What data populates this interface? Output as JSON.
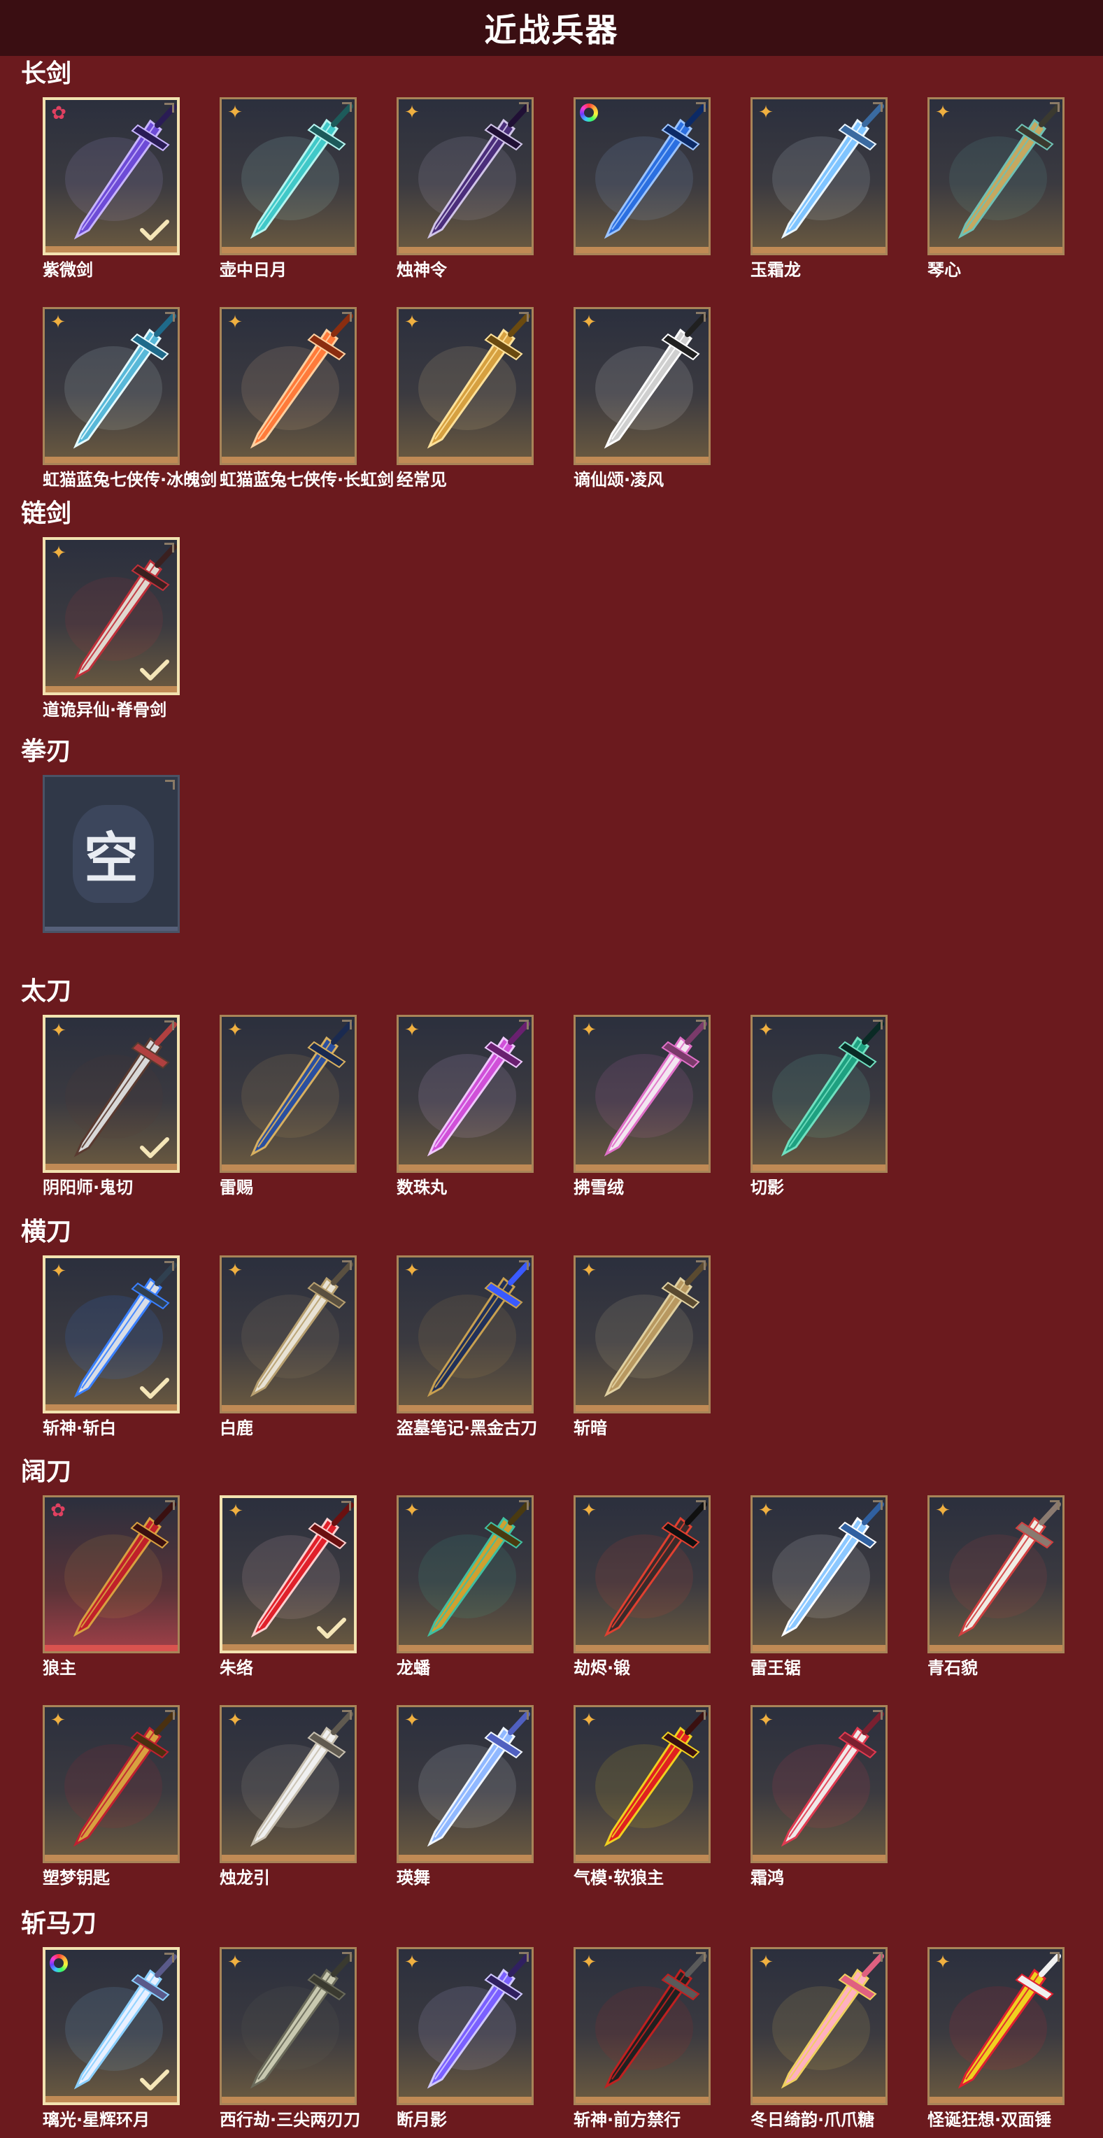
{
  "title": "近战兵器",
  "sections": [
    {
      "label": "长剑",
      "items": [
        {
          "name": "紫微剑",
          "badge": "flower-red",
          "selected": true,
          "weapon": "sword-purple"
        },
        {
          "name": "壶中日月",
          "badge": "star",
          "weapon": "sword-cyan"
        },
        {
          "name": "烛神令",
          "badge": "star",
          "weapon": "sword-dark-purple"
        },
        {
          "name": "",
          "badge": "rainbow",
          "weapon": "sword-blue"
        },
        {
          "name": "玉霜龙",
          "badge": "star",
          "weapon": "sword-ice"
        },
        {
          "name": "琴心",
          "badge": "star",
          "weapon": "sword-gold-teal"
        },
        {
          "name": "虹猫蓝兔七侠传·冰魄剑",
          "badge": "star",
          "weapon": "sword-icy-blue"
        },
        {
          "name": "虹猫蓝兔七侠传·长虹剑",
          "badge": "star",
          "weapon": "sword-orange"
        },
        {
          "name": "经常见",
          "badge": "star",
          "weapon": "sword-golden"
        },
        {
          "name": "谪仙颂·凌风",
          "badge": "star",
          "weapon": "sword-silver"
        }
      ]
    },
    {
      "label": "链剑",
      "items": [
        {
          "name": "道诡异仙·脊骨剑",
          "badge": "star",
          "selected": true,
          "weapon": "sword-bone"
        }
      ]
    },
    {
      "label": "拳刃",
      "items": [
        {
          "name": "",
          "empty": true,
          "empty_text": "空"
        }
      ]
    },
    {
      "label": "太刀",
      "items": [
        {
          "name": "阴阳师·鬼切",
          "badge": "star",
          "selected": true,
          "weapon": "katana-pair"
        },
        {
          "name": "雷赐",
          "badge": "star",
          "weapon": "katana-blue-gold"
        },
        {
          "name": "数珠丸",
          "badge": "star",
          "weapon": "katana-pink"
        },
        {
          "name": "拂雪绒",
          "badge": "star",
          "weapon": "katana-white-pink"
        },
        {
          "name": "切影",
          "badge": "star",
          "weapon": "katana-green"
        }
      ]
    },
    {
      "label": "横刀",
      "items": [
        {
          "name": "斩神·斩白",
          "badge": "star",
          "selected": true,
          "weapon": "saber-silver-blue"
        },
        {
          "name": "白鹿",
          "badge": "star",
          "weapon": "saber-white"
        },
        {
          "name": "盗墓笔记·黑金古刀",
          "badge": "star",
          "weapon": "saber-black-gold"
        },
        {
          "name": "斩暗",
          "badge": "star",
          "weapon": "saber-bronze"
        }
      ]
    },
    {
      "label": "阔刀",
      "items": [
        {
          "name": "狼主",
          "badge": "flower-red",
          "red": true,
          "weapon": "blade-red-gold"
        },
        {
          "name": "朱络",
          "badge": "star",
          "selected": true,
          "weapon": "blade-red"
        },
        {
          "name": "龙蟠",
          "badge": "star",
          "weapon": "blade-gold-green"
        },
        {
          "name": "劫烬·锻",
          "badge": "star",
          "weapon": "blade-dark-red"
        },
        {
          "name": "雷王锯",
          "badge": "star",
          "weapon": "blade-blue-white"
        },
        {
          "name": "青石貌",
          "badge": "star",
          "weapon": "blade-white-red"
        },
        {
          "name": "塑梦钥匙",
          "badge": "star",
          "weapon": "blade-gold-red"
        },
        {
          "name": "烛龙引",
          "badge": "star",
          "weapon": "blade-white-silver"
        },
        {
          "name": "瑛舞",
          "badge": "star",
          "weapon": "blade-light-blue"
        },
        {
          "name": "气模·软狼主",
          "badge": "star",
          "weapon": "blade-inflatable"
        },
        {
          "name": "霜鸿",
          "badge": "star",
          "weapon": "blade-crimson-white"
        }
      ]
    },
    {
      "label": "斩马刀",
      "items": [
        {
          "name": "璃光·星辉环月",
          "badge": "rainbow",
          "selected": true,
          "weapon": "halberd-moon"
        },
        {
          "name": "西行劫·三尖两刃刀",
          "badge": "star",
          "weapon": "halberd-trident"
        },
        {
          "name": "断月影",
          "badge": "star",
          "weapon": "halberd-purple"
        },
        {
          "name": "斩神·前方禁行",
          "badge": "star",
          "weapon": "halberd-sign"
        },
        {
          "name": "冬日绮韵·爪爪糖",
          "badge": "star",
          "weapon": "halberd-candy"
        },
        {
          "name": "怪诞狂想·双面锤",
          "badge": "star",
          "weapon": "halberd-clown"
        }
      ]
    }
  ],
  "colors": {
    "background": "#6b1a1e",
    "titlebar": "#3a0e12",
    "card_border": "#a88458",
    "selected_border": "#f2e2b0",
    "star_badge": "#f0b040",
    "flower_badge": "#e04060"
  }
}
